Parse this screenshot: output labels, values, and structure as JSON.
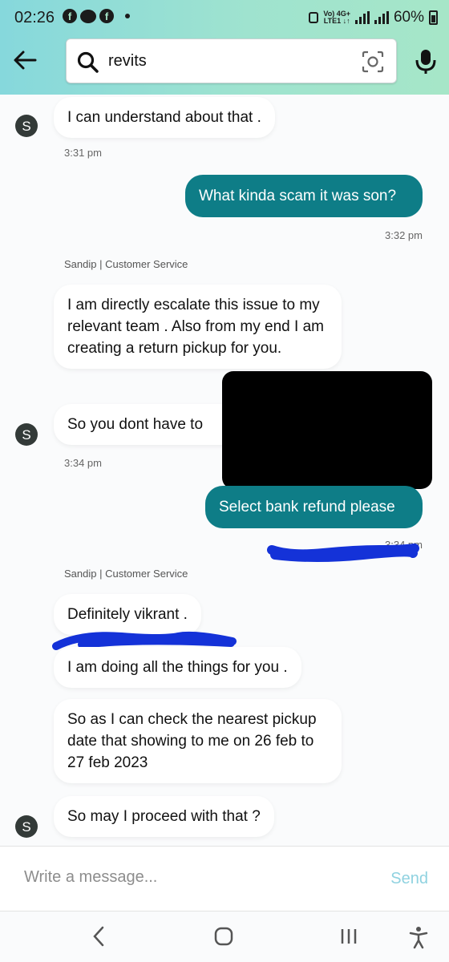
{
  "status_bar": {
    "time": "02:26",
    "network": "Vo) 4G+ LTE1",
    "battery": "60%"
  },
  "header": {
    "search_value": "revits",
    "colors": {
      "gradient_start": "#86d8dc",
      "gradient_end": "#a6e6c8"
    }
  },
  "messages": [
    {
      "text": "I can understand about  that .",
      "time": "3:31 pm"
    },
    {
      "text": "What kinda scam it was son?",
      "time": "3:32 pm"
    },
    {
      "sender": "Sandip | Customer Service",
      "text": "I am directly escalate this issue  to my relevant  team . Also from my end I am creating a return pickup for  you."
    },
    {
      "text": "So you dont  have to",
      "time": "3:34 pm"
    },
    {
      "text": "Select bank refund please",
      "time": "3:34 pm"
    },
    {
      "sender": "Sandip | Customer Service",
      "text": "Definitely vikrant  ."
    },
    {
      "text": "I  am doing all  the things for  you ."
    },
    {
      "text": "So as I  can check the nearest pickup date that  showing to me on  26 feb to 27 feb 2023"
    },
    {
      "text": "So  may I proceed with that ?"
    }
  ],
  "avatar_letter": "S",
  "compose": {
    "placeholder": "Write a message...",
    "send_label": "Send"
  },
  "accent_color": "#0e7d87"
}
